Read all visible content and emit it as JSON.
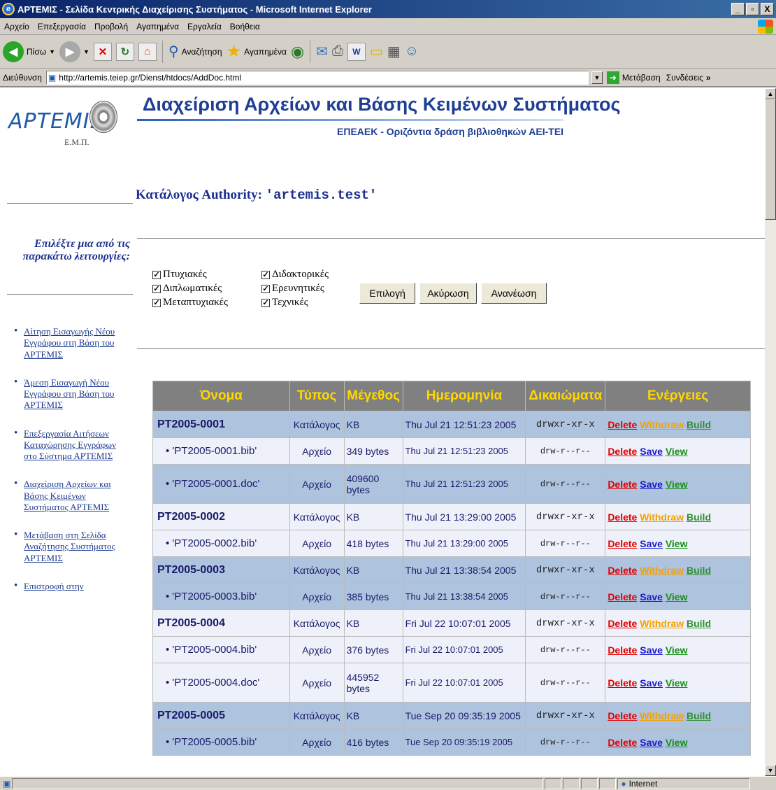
{
  "window": {
    "title": "ΑΡΤΕΜΙΣ - Σελίδα Κεντρικής Διαχείρισης Συστήματος - Microsoft Internet Explorer"
  },
  "menu": [
    "Αρχείο",
    "Επεξεργασία",
    "Προβολή",
    "Αγαπημένα",
    "Εργαλεία",
    "Βοήθεια"
  ],
  "toolbar": {
    "back": "Πίσω",
    "search": "Αναζήτηση",
    "favorites": "Αγαπημένα"
  },
  "address": {
    "label": "Διεύθυνση",
    "url": "http://artemis.teiep.gr/Dienst/htdocs/AddDoc.html",
    "go": "Μετάβαση",
    "links": "Συνδέσεις"
  },
  "status": {
    "zone": "Internet"
  },
  "page": {
    "logo_text": "ΑΡΤΕΜΙΣ",
    "logo_sub": "Ε.Μ.Π.",
    "heading": "Διαχείριση Αρχείων και Βάσης Κειμένων Συστήματος",
    "subheading": "ΕΠΕΑΕΚ - Οριζόντια δράση βιβλιοθηκών ΑΕΙ-ΤΕΙ",
    "catalog_prefix": "Κατάλογος Authority: ",
    "catalog_name": "'artemis.test'",
    "select_prompt": "Επιλέξτε μια από τις παρακάτω λειτουργίες:",
    "nav": [
      "Αίτηση Εισαγωγής Νέου Εγγράφου στη Βάση του ΑΡΤΕΜΙΣ",
      "Άμεση Εισαγωγή Νέου Εγγράφου στη Βάση του ΑΡΤΕΜΙΣ",
      "Επεξεργασία Αιτήσεων Καταχώρησης Εγγράφων στο Σύστημα ΑΡΤΕΜΙΣ",
      "Διαχείριση Αρχείων και Βάσης Κειμένων Συστήματος ΑΡΤΕΜΙΣ",
      "Μετάβαση στη Σελίδα Αναζήτησης Συστήματος ΑΡΤΕΜΙΣ",
      "Επιστροφή στην"
    ],
    "checkboxes": [
      "Πτυχιακές",
      "Διδακτορικές",
      "Διπλωματικές",
      "Ερευνητικές",
      "Μεταπτυχιακές",
      "Τεχνικές"
    ],
    "buttons": {
      "select": "Επιλογή",
      "cancel": "Ακύρωση",
      "refresh": "Ανανέωση"
    },
    "table": {
      "headers": [
        "Όνομα",
        "Τύπος",
        "Μέγεθος",
        "Ημερομηνία",
        "Δικαιώματα",
        "Ενέργειες"
      ],
      "actions": {
        "delete": "Delete",
        "withdraw": "Withdraw",
        "build": "Build",
        "save": "Save",
        "view": "View"
      },
      "rows": [
        {
          "name": "PT2005-0001",
          "type": "Κατάλογος",
          "size": "KB",
          "date": "Thu Jul 21 12:51:23 2005",
          "perm": "drwxr-xr-x"
        },
        {
          "name": "'PT2005-0001.bib'",
          "type": "Αρχείο",
          "size": "349 bytes",
          "date": "Thu Jul 21 12:51:23 2005",
          "perm": "drw-r--r--"
        },
        {
          "name": "'PT2005-0001.doc'",
          "type": "Αρχείο",
          "size": "409600 bytes",
          "date": "Thu Jul 21 12:51:23 2005",
          "perm": "drw-r--r--"
        },
        {
          "name": "PT2005-0002",
          "type": "Κατάλογος",
          "size": "KB",
          "date": "Thu Jul 21 13:29:00 2005",
          "perm": "drwxr-xr-x"
        },
        {
          "name": "'PT2005-0002.bib'",
          "type": "Αρχείο",
          "size": "418 bytes",
          "date": "Thu Jul 21 13:29:00 2005",
          "perm": "drw-r--r--"
        },
        {
          "name": "PT2005-0003",
          "type": "Κατάλογος",
          "size": "KB",
          "date": "Thu Jul 21 13:38:54 2005",
          "perm": "drwxr-xr-x"
        },
        {
          "name": "'PT2005-0003.bib'",
          "type": "Αρχείο",
          "size": "385 bytes",
          "date": "Thu Jul 21 13:38:54 2005",
          "perm": "drw-r--r--"
        },
        {
          "name": "PT2005-0004",
          "type": "Κατάλογος",
          "size": "KB",
          "date": "Fri Jul 22 10:07:01 2005",
          "perm": "drwxr-xr-x"
        },
        {
          "name": "'PT2005-0004.bib'",
          "type": "Αρχείο",
          "size": "376 bytes",
          "date": "Fri Jul 22 10:07:01 2005",
          "perm": "drw-r--r--"
        },
        {
          "name": "'PT2005-0004.doc'",
          "type": "Αρχείο",
          "size": "445952 bytes",
          "date": "Fri Jul 22 10:07:01 2005",
          "perm": "drw-r--r--"
        },
        {
          "name": "PT2005-0005",
          "type": "Κατάλογος",
          "size": "KB",
          "date": "Tue Sep 20 09:35:19 2005",
          "perm": "drwxr-xr-x"
        },
        {
          "name": "'PT2005-0005.bib'",
          "type": "Αρχείο",
          "size": "416 bytes",
          "date": "Tue Sep 20 09:35:19 2005",
          "perm": "drw-r--r--"
        }
      ]
    }
  }
}
